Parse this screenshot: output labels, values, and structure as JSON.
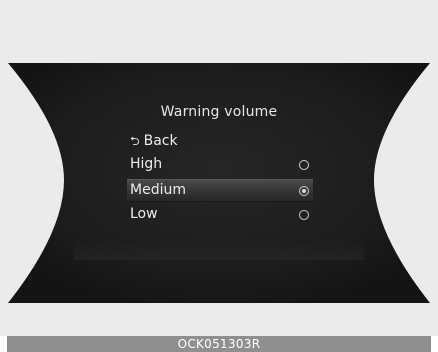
{
  "menu": {
    "title": "Warning volume",
    "back_label": "Back",
    "options": [
      {
        "label": "High",
        "selected": false
      },
      {
        "label": "Medium",
        "selected": true
      },
      {
        "label": "Low",
        "selected": false
      }
    ],
    "highlighted_option": "Medium"
  },
  "caption": {
    "code": "OCK051303R"
  },
  "colors": {
    "screen_bg": "#1c1c1c",
    "figure_bg": "#ebebeb",
    "text": "#ececec",
    "caption_bar": "#8f8f8f"
  },
  "icons": {
    "back": "back-arrow-icon",
    "radio_unselected": "radio-unselected-icon",
    "radio_selected": "radio-selected-icon"
  }
}
